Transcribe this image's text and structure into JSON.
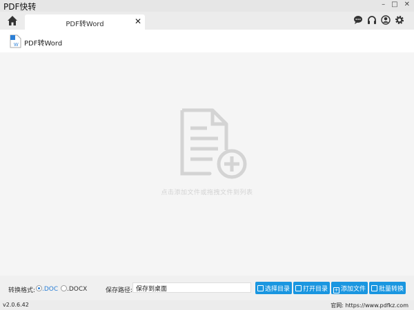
{
  "window": {
    "title": "PDF快转",
    "minimize": "–",
    "maximize": "□",
    "close": "✕"
  },
  "tabs": [
    {
      "label": "PDF转Word",
      "close": "✕"
    }
  ],
  "toolbar_icons": [
    "chat-icon",
    "headset-icon",
    "user-icon",
    "gear-icon"
  ],
  "header": {
    "title": "PDF转Word"
  },
  "drop_area": {
    "hint": "点击添加文件或拖拽文件到列表"
  },
  "bottom": {
    "format_label": "转换格式:",
    "formats": [
      {
        "label": ".DOC",
        "selected": true
      },
      {
        "label": ".DOCX",
        "selected": false
      }
    ],
    "path_label": "保存路径:",
    "path_value": "保存到桌面",
    "buttons": [
      {
        "label": "选择目录"
      },
      {
        "label": "打开目录"
      },
      {
        "label": "添加文件"
      },
      {
        "label": "批量转换"
      }
    ]
  },
  "status": {
    "version": "v2.0.6.42",
    "site": "官网: https://www.pdfkz.com"
  },
  "colors": {
    "accent": "#1a96e0"
  }
}
